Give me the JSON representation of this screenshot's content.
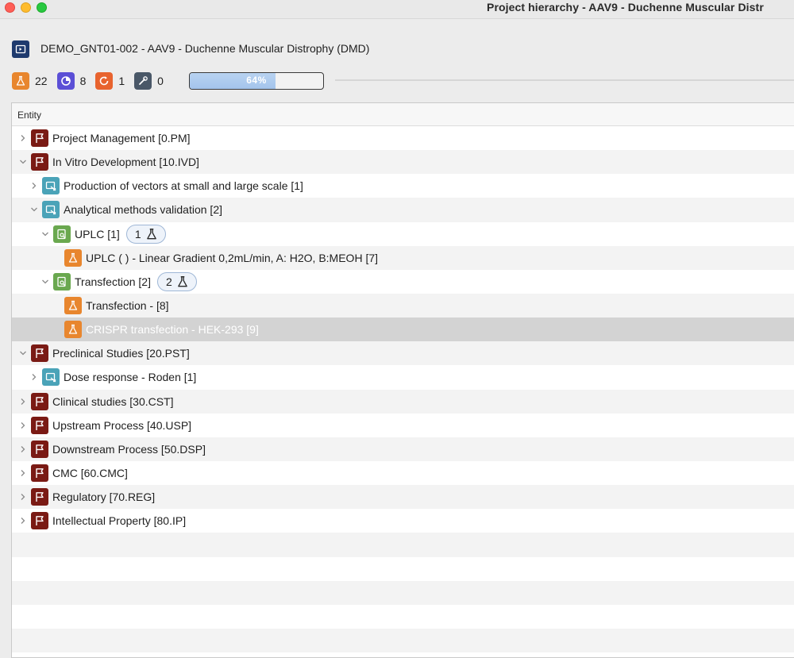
{
  "window": {
    "title": "Project hierarchy - AAV9 - Duchenne Muscular Distr"
  },
  "header": {
    "project_title": "DEMO_GNT01-002 - AAV9 - Duchenne Muscular Distrophy (DMD)",
    "counters": [
      {
        "icon": "flask-icon",
        "value": "22",
        "color": "#e8862e"
      },
      {
        "icon": "progress-circle-icon",
        "value": "8",
        "color": "#5b4fd6"
      },
      {
        "icon": "refresh-icon",
        "value": "1",
        "color": "#e8632e"
      },
      {
        "icon": "tools-icon",
        "value": "0",
        "color": "#4a5868"
      }
    ],
    "progress": {
      "label": "64%",
      "value": 0.64
    }
  },
  "tree": {
    "column_header": "Entity",
    "rows": [
      {
        "label": "Project Management [0.PM]",
        "type": "flag",
        "level": 0,
        "expanded": false
      },
      {
        "label": "In Vitro Development [10.IVD]",
        "type": "flag",
        "level": 0,
        "expanded": true
      },
      {
        "label": "Production of vectors at small and large scale [1]",
        "type": "study",
        "level": 1,
        "expanded": false
      },
      {
        "label": "Analytical methods validation [2]",
        "type": "study",
        "level": 1,
        "expanded": true
      },
      {
        "label": "UPLC [1]",
        "type": "experiment",
        "level": 2,
        "expanded": true,
        "badge": "1"
      },
      {
        "label": "UPLC ( ) - Linear Gradient 0,2mL/min, A: H2O, B:MEOH [7]",
        "type": "test",
        "level": 3
      },
      {
        "label": "Transfection [2]",
        "type": "experiment",
        "level": 2,
        "expanded": true,
        "badge": "2"
      },
      {
        "label": "Transfection -  [8]",
        "type": "test",
        "level": 3
      },
      {
        "label": "CRISPR transfection - HEK-293 [9]",
        "type": "test",
        "level": 3,
        "selected": true
      },
      {
        "label": "Preclinical Studies [20.PST]",
        "type": "flag",
        "level": 0,
        "expanded": true
      },
      {
        "label": "Dose response - Roden [1]",
        "type": "study",
        "level": 1,
        "expanded": false
      },
      {
        "label": "Clinical studies [30.CST]",
        "type": "flag",
        "level": 0,
        "expanded": false
      },
      {
        "label": "Upstream Process [40.USP]",
        "type": "flag",
        "level": 0,
        "expanded": false
      },
      {
        "label": "Downstream Process [50.DSP]",
        "type": "flag",
        "level": 0,
        "expanded": false
      },
      {
        "label": "CMC [60.CMC]",
        "type": "flag",
        "level": 0,
        "expanded": false
      },
      {
        "label": "Regulatory [70.REG]",
        "type": "flag",
        "level": 0,
        "expanded": false
      },
      {
        "label": "Intellectual Property [80.IP]",
        "type": "flag",
        "level": 0,
        "expanded": false
      }
    ]
  }
}
